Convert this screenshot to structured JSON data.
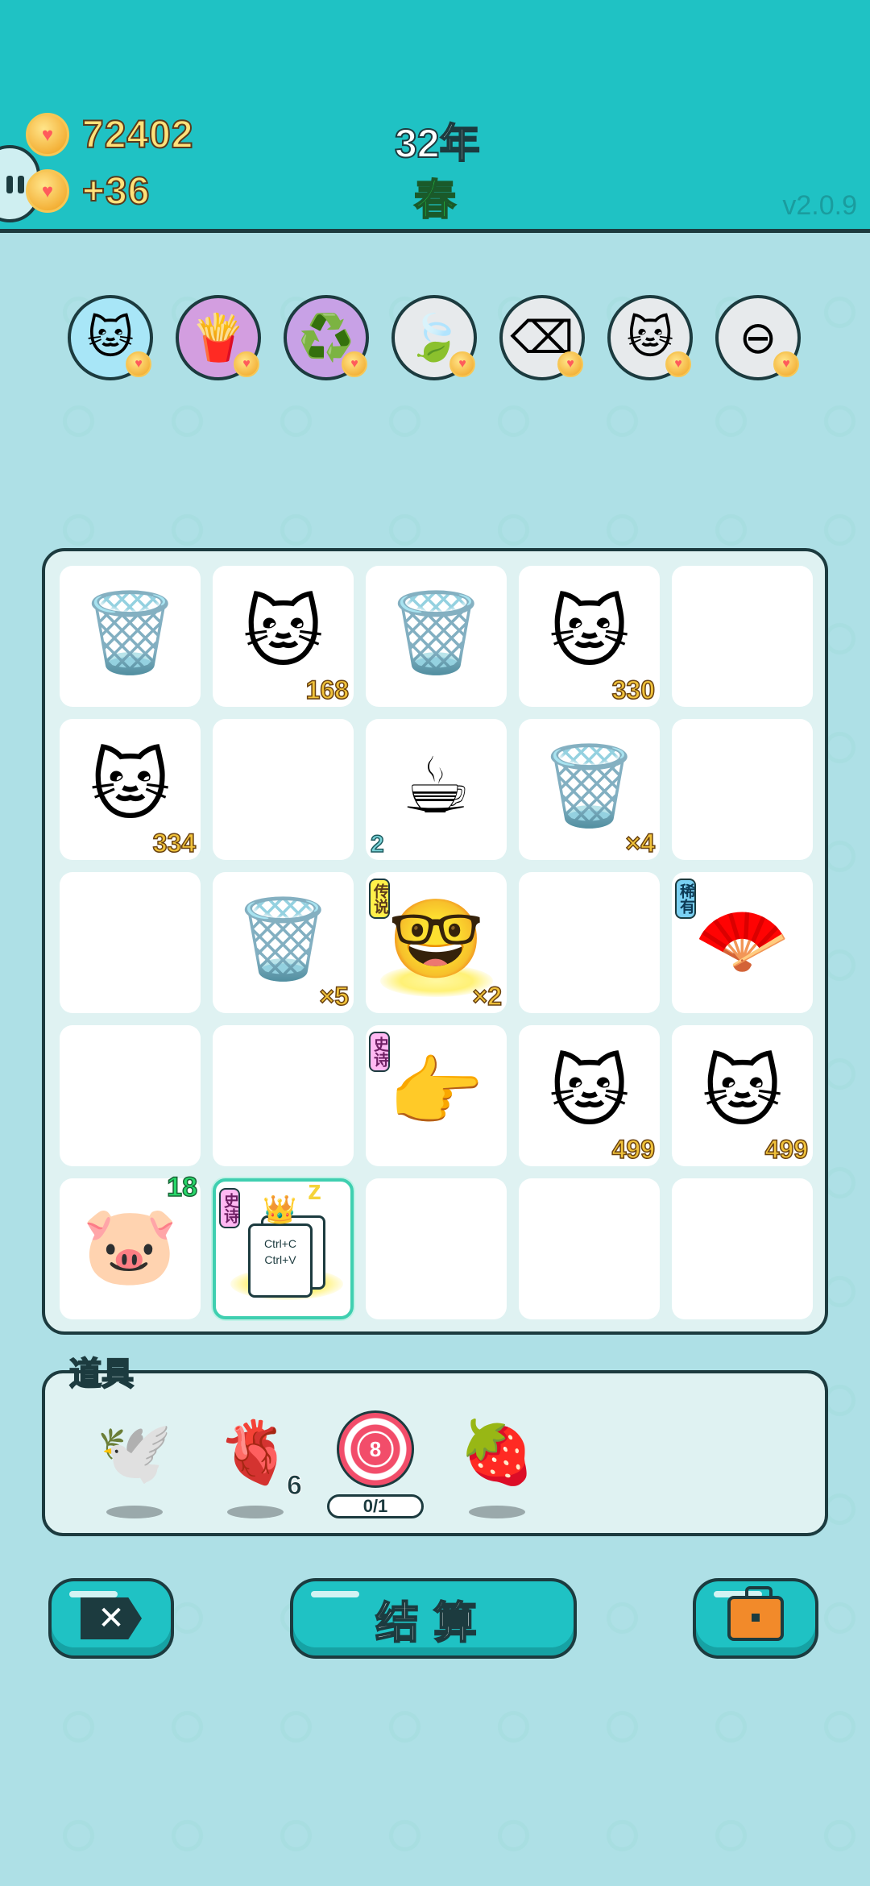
{
  "header": {
    "coins": "72402",
    "income": "+36",
    "year": "32年",
    "season": "春",
    "version": "v2.0.9"
  },
  "skills": [
    {
      "name": "cat-coin-icon",
      "glyph": "🐱",
      "bg": "#a8e6f7"
    },
    {
      "name": "fries-icon",
      "glyph": "🍟",
      "bg": "#d39ee0"
    },
    {
      "name": "recycle-icon",
      "glyph": "♻️",
      "bg": "#c8a1e6"
    },
    {
      "name": "leaf-icon",
      "glyph": "🍃",
      "bg": "#e7eaec"
    },
    {
      "name": "remove-tag-icon",
      "glyph": "⌫",
      "bg": "#e7eaec"
    },
    {
      "name": "twin-cats-icon",
      "glyph": "🐱",
      "bg": "#e7eaec"
    },
    {
      "name": "minus-circle-icon",
      "glyph": "⊖",
      "bg": "#e7eaec"
    }
  ],
  "board": [
    [
      {
        "item": "trash-bag",
        "glyph": "🗑️"
      },
      {
        "item": "cat",
        "glyph": "🐱",
        "count": "168"
      },
      {
        "item": "trash-bag",
        "glyph": "🗑️"
      },
      {
        "item": "cat",
        "glyph": "🐱",
        "count": "330"
      },
      {
        "item": "empty"
      }
    ],
    [
      {
        "item": "cat",
        "glyph": "🐱",
        "count": "334"
      },
      {
        "item": "empty"
      },
      {
        "item": "coffee",
        "glyph": "☕",
        "left": "2"
      },
      {
        "item": "trash-bag",
        "glyph": "🗑️",
        "count": "×4"
      },
      {
        "item": "empty"
      }
    ],
    [
      {
        "item": "empty"
      },
      {
        "item": "trash-bag",
        "glyph": "🗑️",
        "count": "×5"
      },
      {
        "item": "king",
        "glyph": "🤓",
        "count": "×2",
        "tag": "传说",
        "tagType": "legend"
      },
      {
        "item": "empty"
      },
      {
        "item": "fan",
        "glyph": "🪭",
        "tag": "稀有",
        "tagType": "rare"
      }
    ],
    [
      {
        "item": "empty"
      },
      {
        "item": "empty"
      },
      {
        "item": "pointer-hand",
        "glyph": "👉",
        "tag": "史诗",
        "tagType": "epic"
      },
      {
        "item": "cat",
        "glyph": "🐱",
        "count": "499"
      },
      {
        "item": "cat",
        "glyph": "🐱",
        "count": "499"
      }
    ],
    [
      {
        "item": "pig",
        "glyph": "🐷",
        "top": "18"
      },
      {
        "item": "ctrl-cv",
        "tag": "史诗",
        "tagType": "epic",
        "line1": "Ctrl+C",
        "line2": "Ctrl+V",
        "selected": true
      },
      {
        "item": "empty"
      },
      {
        "item": "empty"
      },
      {
        "item": "empty"
      }
    ]
  ],
  "props": {
    "label": "道具",
    "items": [
      {
        "name": "white-bird-icon",
        "glyph": "🕊️"
      },
      {
        "name": "liver-icon",
        "glyph": "🫀",
        "count": "6"
      },
      {
        "name": "target-icon",
        "number": "8",
        "progress": "0/1"
      },
      {
        "name": "bayberry-icon",
        "glyph": "🍓"
      }
    ]
  },
  "buttons": {
    "settle": "结算"
  }
}
